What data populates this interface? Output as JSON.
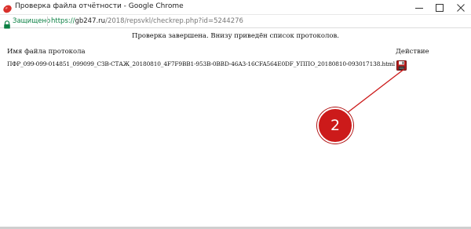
{
  "window": {
    "title": "Проверка файла отчётности - Google Chrome",
    "minimize_icon": "minimize-icon",
    "maximize_icon": "maximize-icon",
    "close_icon": "close-icon",
    "app_icon": "app-icon",
    "app_icon_color": "#d9302b"
  },
  "address_bar": {
    "secure_label": "Защищено",
    "url_scheme": "https://",
    "url_host": "gb247.ru",
    "url_path": "/2018/repsvkl/checkrep.php?id=5244276",
    "secure_color": "#0b8043"
  },
  "page": {
    "status_message": "Проверка завершена. Внизу приведён список протоколов.",
    "columns": {
      "name": "Имя файла протокола",
      "action": "Действие"
    },
    "protocols": [
      {
        "file_name": "ПФР_099-099-014851_099099_СЗВ-СТАЖ_20180810_4F7F9BB1-953B-0BBD-46A3-16CFA564E0DF_УППО_20180810-093017138.html",
        "action_icon": "floppy-disk-save-icon"
      }
    ]
  },
  "annotation": {
    "marker_label": "2",
    "marker_color": "#cc1a1a"
  }
}
